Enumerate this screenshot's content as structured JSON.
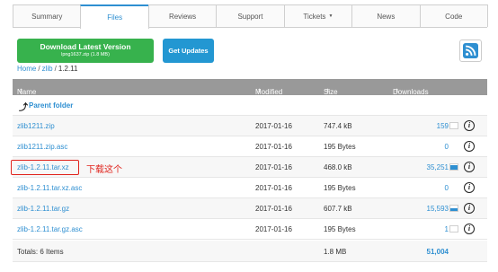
{
  "tabs": [
    {
      "label": "Summary"
    },
    {
      "label": "Files"
    },
    {
      "label": "Reviews"
    },
    {
      "label": "Support"
    },
    {
      "label": "Tickets"
    },
    {
      "label": "News"
    },
    {
      "label": "Code"
    }
  ],
  "active_tab": "Files",
  "download_button": {
    "title": "Download Latest Version",
    "subtitle": "lpng1637.zip (1.8 MB)"
  },
  "updates_button": {
    "label": "Get Updates"
  },
  "rss_icon": "rss-icon",
  "breadcrumb": {
    "home": "Home",
    "sep": "/",
    "zlib": "zlib",
    "current": "1.2.11"
  },
  "table": {
    "headers": {
      "name": "Name",
      "modified": "Modified",
      "size": "Size",
      "downloads": "Downloads / Week"
    },
    "parent_label": "Parent folder",
    "rows": [
      {
        "name": "zlib1211.zip",
        "modified": "2017-01-16",
        "size": "747.4 kB",
        "downloads": "159",
        "weekly_bar_level": 0
      },
      {
        "name": "zlib1211.zip.asc",
        "modified": "2017-01-16",
        "size": "195 Bytes",
        "downloads": "0",
        "weekly_bar_level": null
      },
      {
        "name": "zlib-1.2.11.tar.xz",
        "modified": "2017-01-16",
        "size": "468.0 kB",
        "downloads": "35,251",
        "weekly_bar_level": 0.85
      },
      {
        "name": "zlib-1.2.11.tar.xz.asc",
        "modified": "2017-01-16",
        "size": "195 Bytes",
        "downloads": "0",
        "weekly_bar_level": null
      },
      {
        "name": "zlib-1.2.11.tar.gz",
        "modified": "2017-01-16",
        "size": "607.7 kB",
        "downloads": "15,593",
        "weekly_bar_level": 0.45
      },
      {
        "name": "zlib-1.2.11.tar.gz.asc",
        "modified": "2017-01-16",
        "size": "195 Bytes",
        "downloads": "1",
        "weekly_bar_level": 0
      }
    ],
    "totals": {
      "label": "Totals: 6 Items",
      "size": "1.8 MB",
      "downloads": "51,004"
    }
  },
  "annotation": "下载这个",
  "colors": {
    "link": "#2e8fd1",
    "green_button": "#37b24d",
    "blue_button": "#2397d2",
    "header": "#999999",
    "highlight": "#e0231c"
  }
}
